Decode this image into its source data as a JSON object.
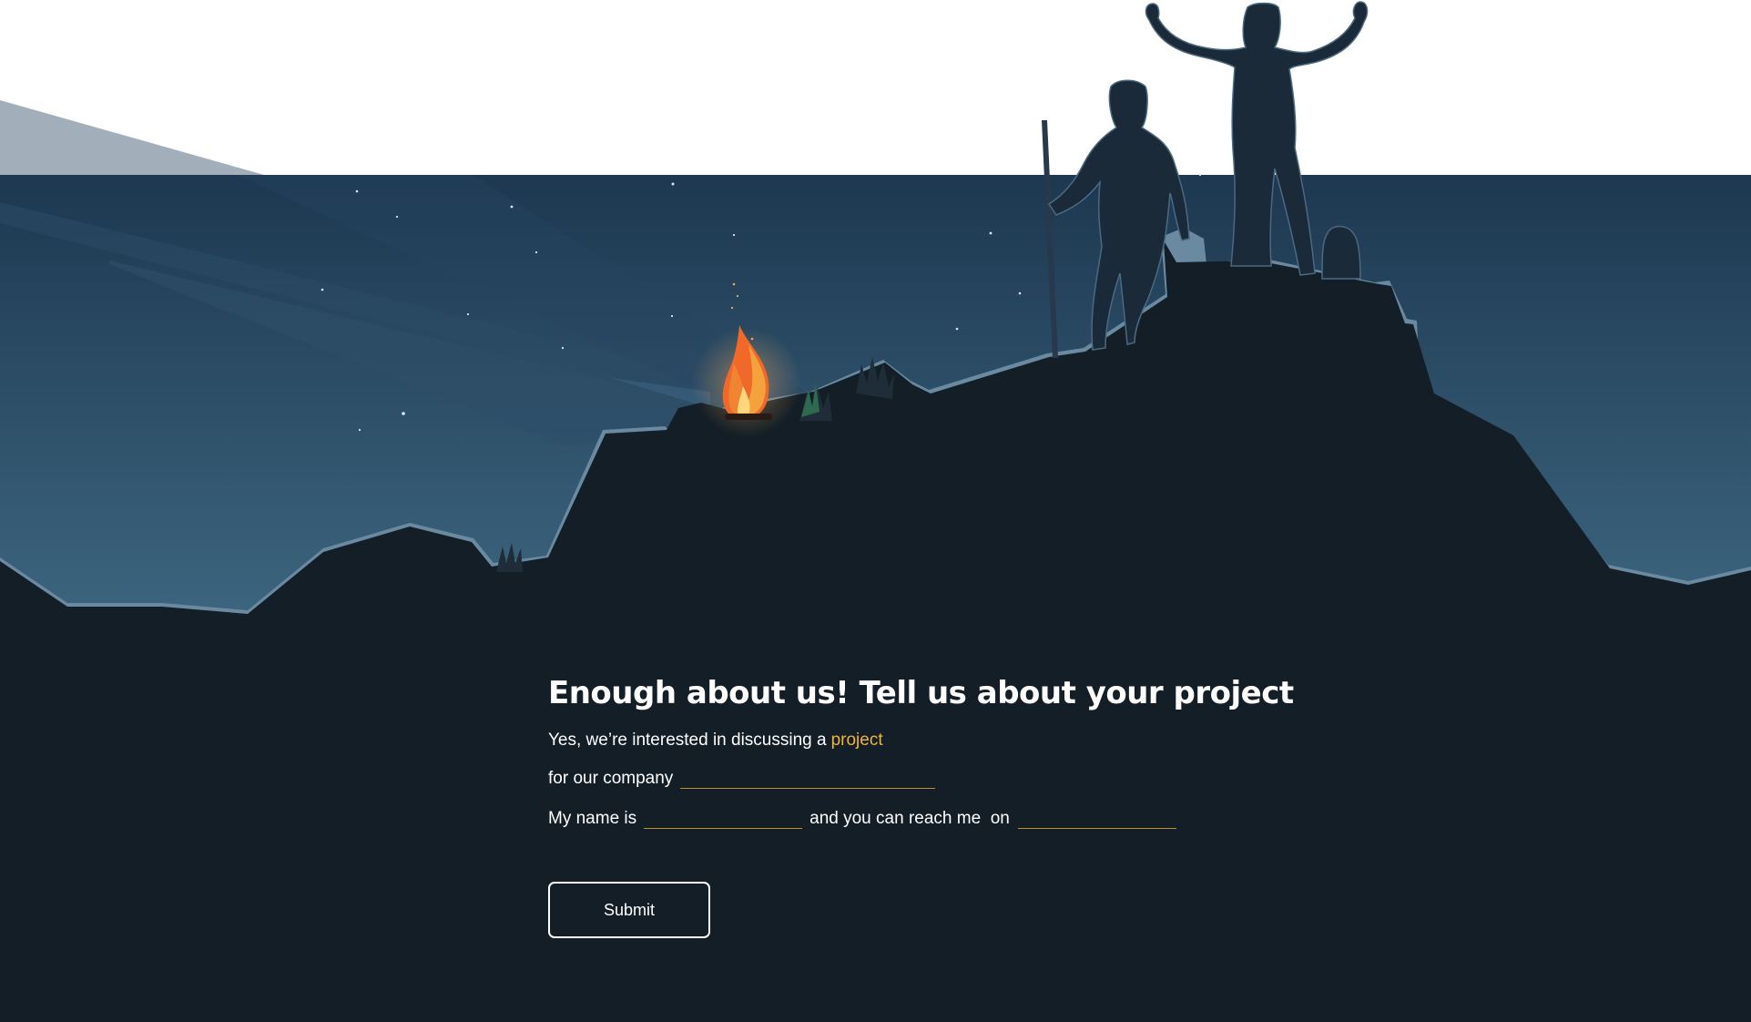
{
  "contact": {
    "title": "Enough about us! Tell us about your project",
    "line1_prefix": "Yes, we’re interested in discussing a",
    "line1_link": "project",
    "line2_prefix": "for our company",
    "line3_prefix": "My name is",
    "line3_middle": "and you can reach me  on",
    "company_value": "",
    "name_value": "",
    "contact_value": "",
    "submit_label": "Submit"
  },
  "colors": {
    "sky_top": "#1f3a52",
    "sky_bottom": "#3c6580",
    "mountain": "#131e26",
    "accent": "#f0b43a",
    "input_underline": "#b8902d",
    "fire": "#f06a28"
  },
  "illustration": {
    "elements": [
      "night-sky",
      "stars",
      "campfire",
      "mountain-silhouette",
      "hiker-with-staff",
      "hiker-arms-raised",
      "backpack",
      "grass-tufts"
    ]
  }
}
